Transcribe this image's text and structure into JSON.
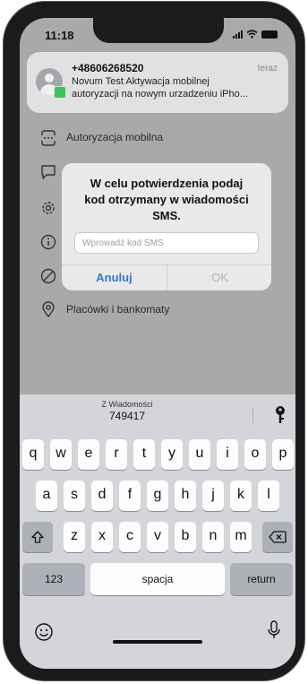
{
  "status_bar": {
    "time": "11:18"
  },
  "notification": {
    "sender": "+48606268520",
    "time": "teraz",
    "line1": "Novum Test Aktywacja mobilnej",
    "line2": "autoryzacji na nowym urzadzeniu iPho..."
  },
  "menu": {
    "items": [
      {
        "label": "Autoryzacja mobilna",
        "icon": "mobile-authorization-icon"
      },
      {
        "label": "",
        "icon": "chat-icon"
      },
      {
        "label": "",
        "icon": "settings-icon"
      },
      {
        "label": "",
        "icon": "info-icon"
      },
      {
        "label": "",
        "icon": "block-icon"
      },
      {
        "label": "Placówki i bankomaty",
        "icon": "location-icon"
      }
    ]
  },
  "dialog": {
    "message_line1": "W celu potwierdzenia podaj",
    "message_line2": "kod otrzymany w wiadomości",
    "message_line3": "SMS.",
    "input_placeholder": "Wprowadź kod SMS",
    "cancel_label": "Anuluj",
    "ok_label": "OK"
  },
  "keyboard": {
    "suggestion_label": "Z Wiadomości",
    "suggestion_code": "749417",
    "row1": [
      "q",
      "w",
      "e",
      "r",
      "t",
      "y",
      "u",
      "i",
      "o",
      "p"
    ],
    "row2": [
      "a",
      "s",
      "d",
      "f",
      "g",
      "h",
      "j",
      "k",
      "l"
    ],
    "row3": [
      "z",
      "x",
      "c",
      "v",
      "b",
      "n",
      "m"
    ],
    "numbers_label": "123",
    "space_label": "spacja",
    "return_label": "return"
  },
  "colors": {
    "accent": "#3478d4",
    "keyboard_bg": "#d4d5da",
    "dim_bg": "#a9a9a9"
  }
}
